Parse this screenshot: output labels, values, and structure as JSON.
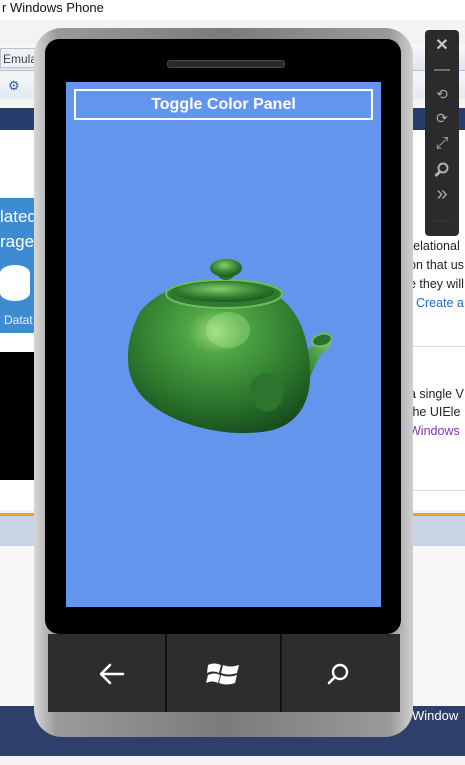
{
  "background_window": {
    "title": "r Windows Phone",
    "tab_label": "Emula",
    "tile_lines": [
      "lated",
      "rage"
    ],
    "tile_caption": "Datat",
    "right_lines": [
      {
        "text": "relational",
        "style": "normal"
      },
      {
        "text": "on that us",
        "style": "normal"
      },
      {
        "text": "e they will",
        "style": "normal"
      },
      {
        "text": ": Create a",
        "style": "link"
      },
      {
        "text": "a single V",
        "style": "normal"
      },
      {
        "text": "the UIEle",
        "style": "normal"
      },
      {
        "text": "Windows",
        "style": "visited"
      }
    ],
    "footer_text": "Window"
  },
  "emulator_toolbar": {
    "buttons": [
      {
        "name": "close-icon",
        "glyph": "✕"
      },
      {
        "name": "minimize-icon",
        "glyph": "—"
      },
      {
        "name": "rotate-left-icon",
        "glyph": "⟲"
      },
      {
        "name": "rotate-right-icon",
        "glyph": "⟳"
      },
      {
        "name": "fit-to-screen-icon",
        "glyph": "⤢"
      },
      {
        "name": "zoom-icon",
        "glyph": "🔍"
      },
      {
        "name": "more-tools-icon",
        "glyph": "»"
      }
    ]
  },
  "phone": {
    "screen_background": "#6495ED",
    "toggle_button_label": "Toggle Color Panel",
    "teapot_color": "#2E7D32",
    "hardware_buttons": [
      {
        "name": "back-button",
        "icon": "back-arrow-icon"
      },
      {
        "name": "start-button",
        "icon": "windows-logo-icon"
      },
      {
        "name": "search-button",
        "icon": "search-icon"
      }
    ]
  }
}
